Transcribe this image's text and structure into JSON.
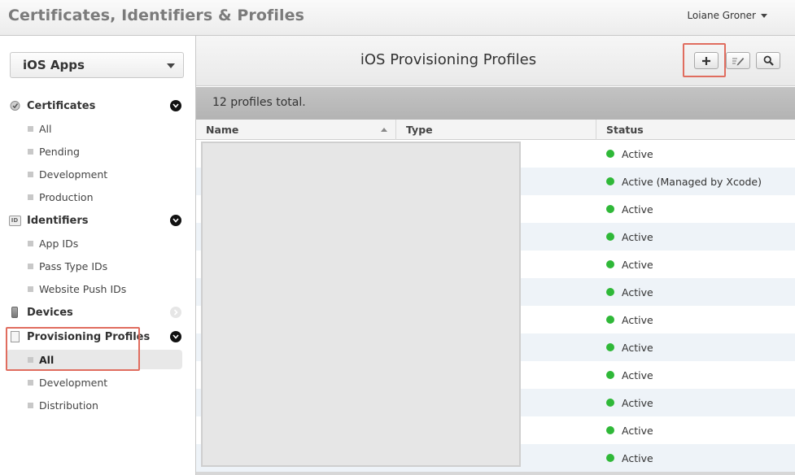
{
  "header": {
    "app_title": "Certificates, Identifiers & Profiles",
    "user_name": "Loiane Groner"
  },
  "sidebar": {
    "platform": "iOS Apps",
    "sections": [
      {
        "label": "Certificates",
        "icon": "certificate-icon",
        "items": [
          "All",
          "Pending",
          "Development",
          "Production"
        ]
      },
      {
        "label": "Identifiers",
        "icon": "id-icon",
        "items": [
          "App IDs",
          "Pass Type IDs",
          "Website Push IDs"
        ]
      },
      {
        "label": "Devices",
        "icon": "device-icon",
        "items": []
      },
      {
        "label": "Provisioning Profiles",
        "icon": "profile-icon",
        "items": [
          "All",
          "Development",
          "Distribution"
        ],
        "selected": "All"
      }
    ]
  },
  "main": {
    "page_title": "iOS Provisioning Profiles",
    "toolbar": [
      "add-icon",
      "edit-icon",
      "search-icon"
    ],
    "summary": "12 profiles total.",
    "columns": [
      "Name",
      "Type",
      "Status"
    ],
    "rows": [
      {
        "status": "Active"
      },
      {
        "status": "Active (Managed by Xcode)"
      },
      {
        "status": "Active"
      },
      {
        "status": "Active"
      },
      {
        "status": "Active"
      },
      {
        "status": "Active"
      },
      {
        "status": "Active"
      },
      {
        "status": "Active"
      },
      {
        "status": "Active"
      },
      {
        "status": "Active"
      },
      {
        "status": "Active"
      },
      {
        "status": "Active"
      }
    ]
  },
  "colors": {
    "status_active": "#2fb838",
    "highlight": "#e06d5f",
    "row_alt": "#eef3f8"
  }
}
